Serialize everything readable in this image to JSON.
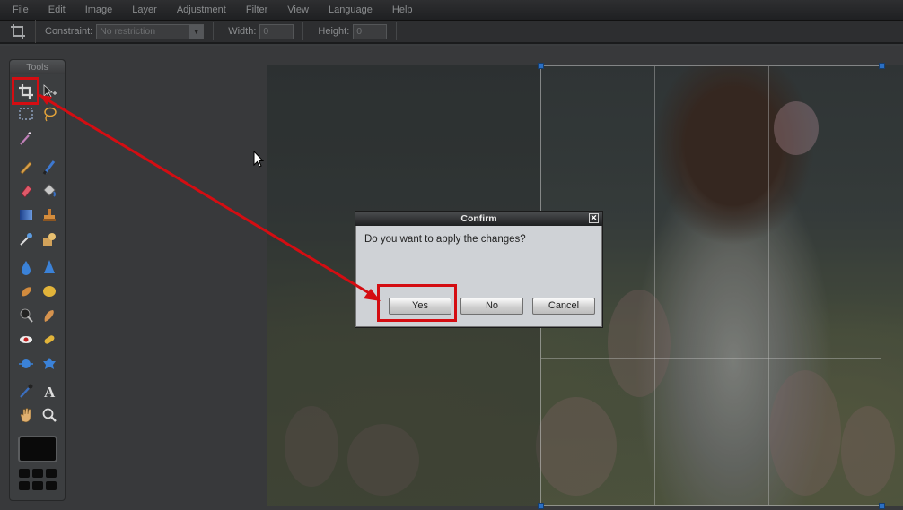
{
  "menubar": {
    "items": [
      "File",
      "Edit",
      "Image",
      "Layer",
      "Adjustment",
      "Filter",
      "View",
      "Language",
      "Help"
    ]
  },
  "options": {
    "tool_icon": "crop-icon",
    "constraint_label": "Constraint:",
    "constraint_value": "No restriction",
    "width_label": "Width:",
    "width_value": "0",
    "height_label": "Height:",
    "height_value": "0"
  },
  "tools": {
    "title": "Tools",
    "icons": [
      "crop-icon",
      "move-icon",
      "marquee-icon",
      "lasso-icon",
      "magic-wand-icon",
      "pencil-icon",
      "brush-icon",
      "eraser-icon",
      "paint-bucket-icon",
      "gradient-icon",
      "clone-stamp-icon",
      "color-replace-icon",
      "drawing-icon",
      "blur-icon",
      "sharpen-icon",
      "smudge-icon",
      "sponge-icon",
      "dodge-icon",
      "burn-icon",
      "red-eye-icon",
      "spot-heal-icon",
      "bloat-icon",
      "pinch-icon",
      "color-picker-icon",
      "type-icon",
      "hand-icon",
      "zoom-icon"
    ]
  },
  "dialog": {
    "title": "Confirm",
    "close_glyph": "✕",
    "message": "Do you want to apply the changes?",
    "yes_label": "Yes",
    "no_label": "No",
    "cancel_label": "Cancel"
  },
  "colors": {
    "annotation_red": "#d40d12",
    "handle_blue": "#2a6fc4"
  }
}
